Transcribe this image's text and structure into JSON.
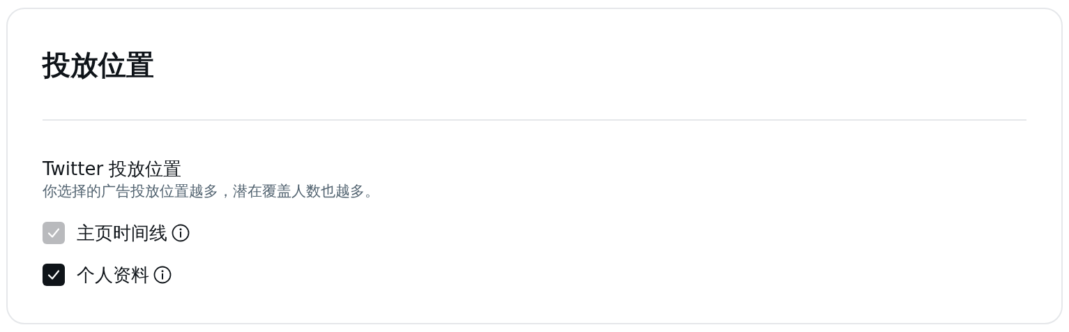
{
  "card": {
    "title": "投放位置"
  },
  "section": {
    "title": "Twitter 投放位置",
    "description": "你选择的广告投放位置越多，潜在覆盖人数也越多。"
  },
  "options": [
    {
      "label": "主页时间线",
      "checked": true,
      "disabled": true
    },
    {
      "label": "个人资料",
      "checked": true,
      "disabled": false
    }
  ]
}
